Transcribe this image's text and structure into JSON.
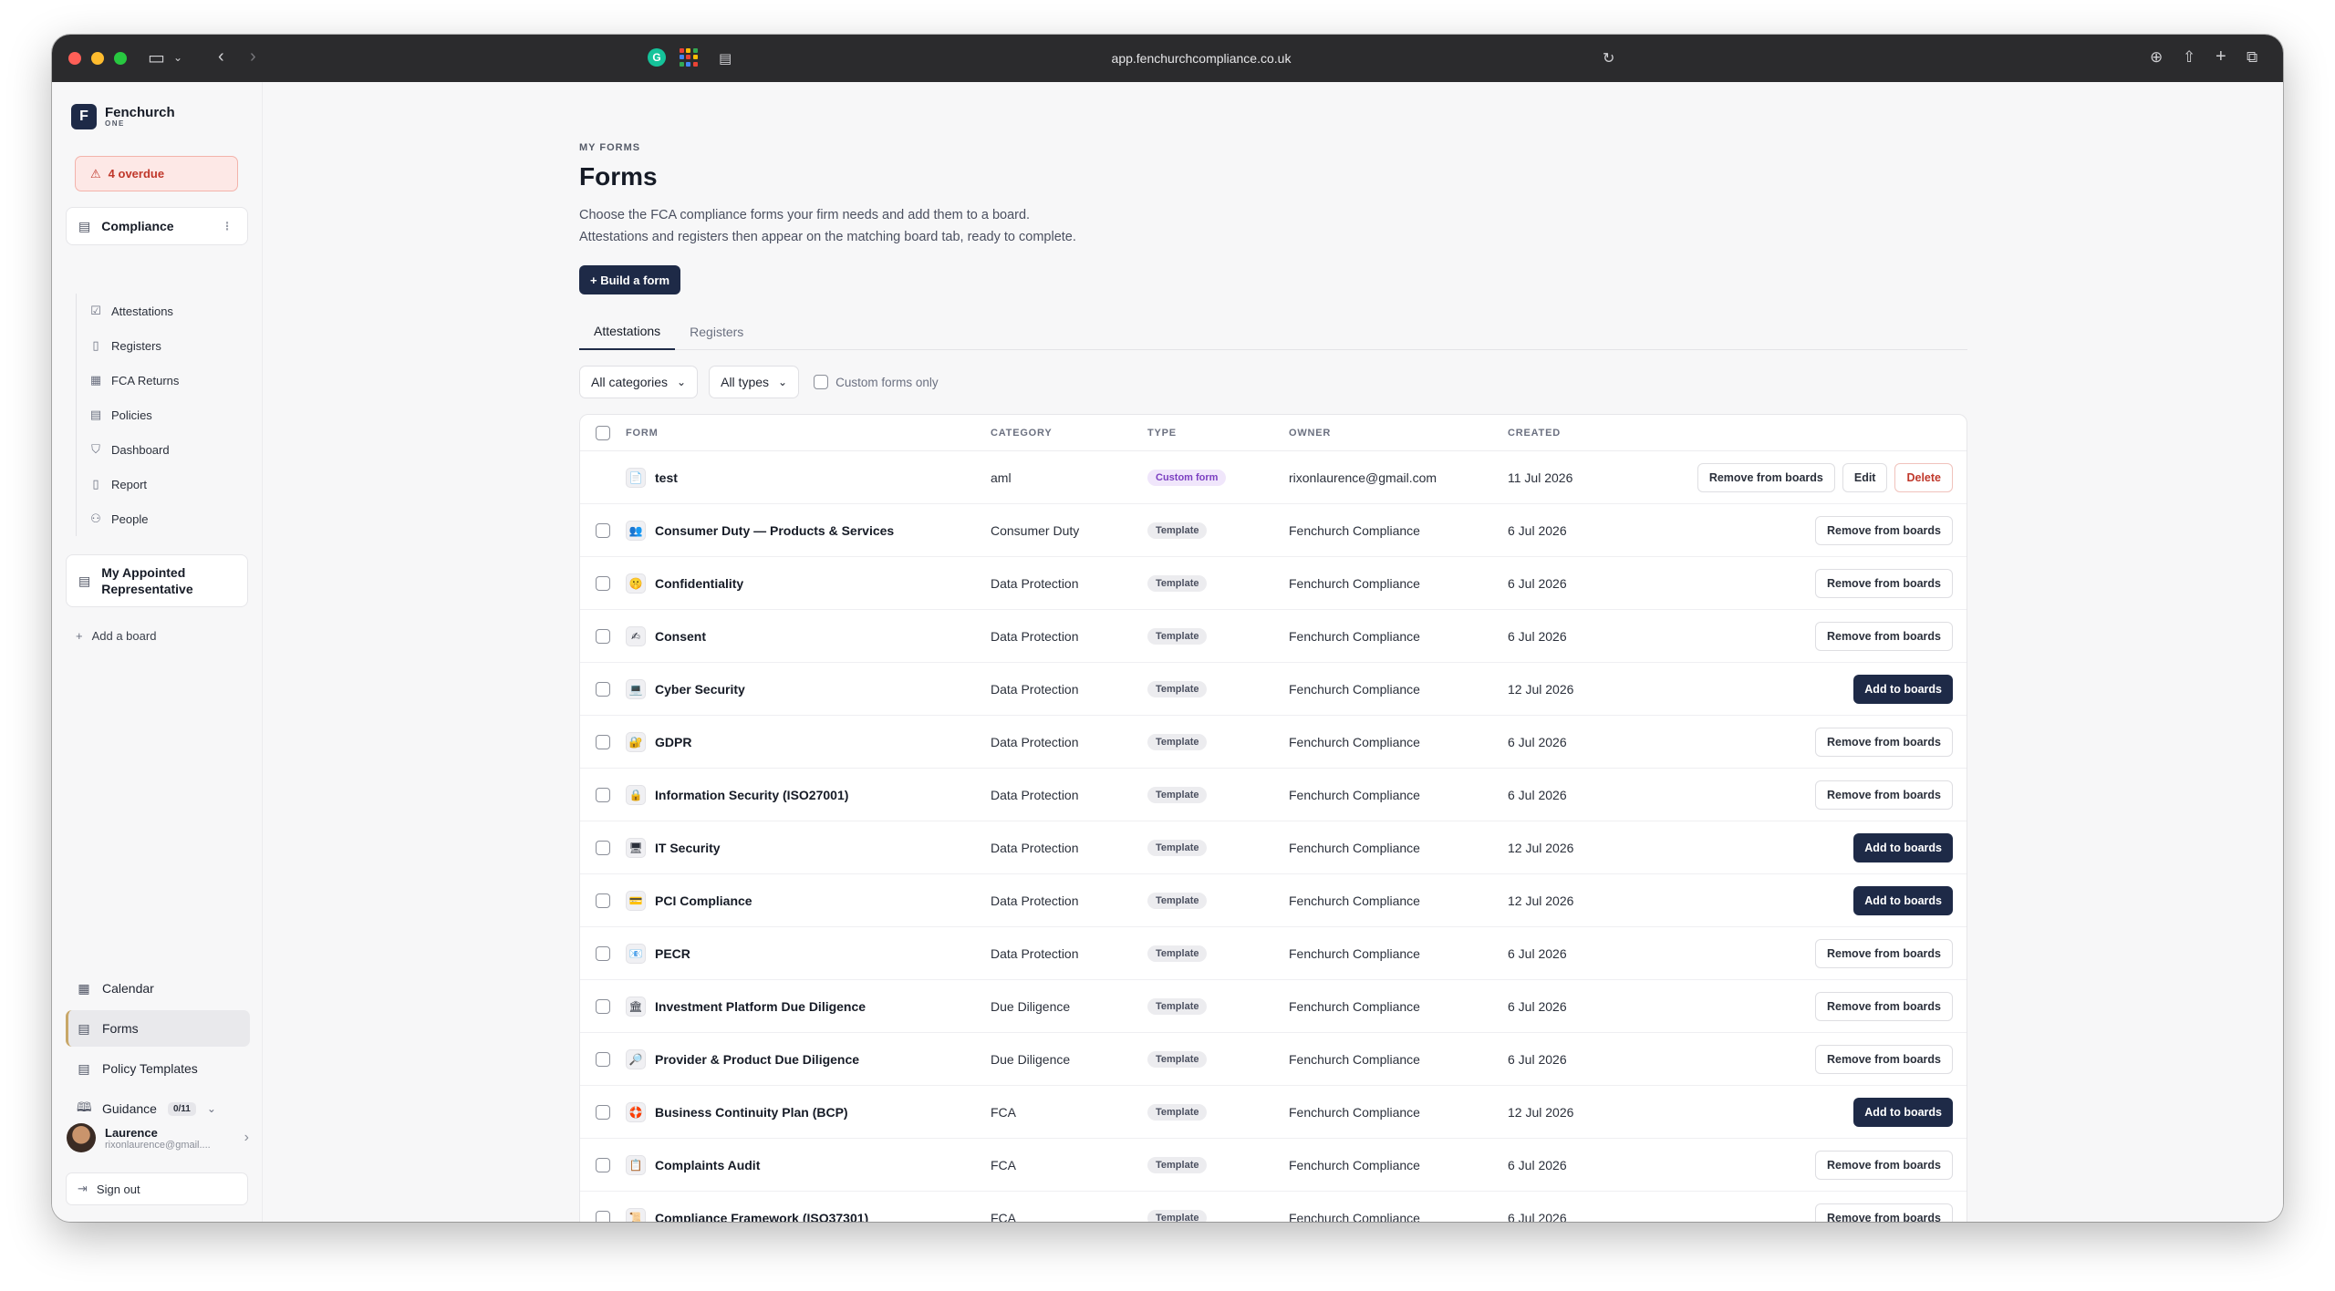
{
  "browser": {
    "url": "app.fenchurchcompliance.co.uk"
  },
  "brand": {
    "name": "Fenchurch",
    "sub": "ONE",
    "logo_letter": "F"
  },
  "alert": {
    "overdue": "4 overdue"
  },
  "sidebar": {
    "compliance_board": "Compliance",
    "compliance_items": [
      {
        "label": "Attestations",
        "icon": "check-square-icon"
      },
      {
        "label": "Registers",
        "icon": "book-icon"
      },
      {
        "label": "FCA Returns",
        "icon": "calendar-icon"
      },
      {
        "label": "Policies",
        "icon": "document-icon"
      },
      {
        "label": "Dashboard",
        "icon": "shield-icon"
      },
      {
        "label": "Report",
        "icon": "file-icon"
      },
      {
        "label": "People",
        "icon": "people-icon"
      }
    ],
    "appointed_board": "My Appointed Representative",
    "add_board": "Add a board",
    "main_nav": [
      {
        "label": "Calendar",
        "icon": "calendar-icon"
      },
      {
        "label": "Forms",
        "icon": "form-icon"
      },
      {
        "label": "Policy Templates",
        "icon": "document-icon"
      },
      {
        "label": "Guidance",
        "icon": "book-open-icon"
      }
    ],
    "guidance_badge": "0/11",
    "user": {
      "name": "Laurence",
      "email": "rixonlaurence@gmail...."
    },
    "sign_out": "Sign out"
  },
  "page": {
    "eyebrow": "MY FORMS",
    "title": "Forms",
    "description_1": "Choose the FCA compliance forms your firm needs and add them to a board.",
    "description_2": "Attestations and registers then appear on the matching board tab, ready to complete.",
    "build_button": "+ Build a form",
    "tabs": [
      "Attestations",
      "Registers"
    ],
    "filters": {
      "category": "All categories",
      "type": "All types",
      "custom_only": "Custom forms only"
    }
  },
  "table": {
    "headers": {
      "form": "FORM",
      "category": "CATEGORY",
      "type": "TYPE",
      "owner": "OWNER",
      "created": "CREATED"
    },
    "rows": [
      {
        "name": "test",
        "icon": "📄",
        "category": "aml",
        "type": "Custom form",
        "owner": "rixonlaurence@gmail.com",
        "created": "11 Jul 2026",
        "actions": [
          "Remove from boards",
          "Edit",
          "Delete"
        ]
      },
      {
        "name": "Consumer Duty — Products & Services",
        "icon": "👥",
        "category": "Consumer Duty",
        "type": "Template",
        "owner": "Fenchurch Compliance",
        "created": "6 Jul 2026",
        "actions": [
          "Remove from boards"
        ]
      },
      {
        "name": "Confidentiality",
        "icon": "🤫",
        "category": "Data Protection",
        "type": "Template",
        "owner": "Fenchurch Compliance",
        "created": "6 Jul 2026",
        "actions": [
          "Remove from boards"
        ]
      },
      {
        "name": "Consent",
        "icon": "✍",
        "category": "Data Protection",
        "type": "Template",
        "owner": "Fenchurch Compliance",
        "created": "6 Jul 2026",
        "actions": [
          "Remove from boards"
        ]
      },
      {
        "name": "Cyber Security",
        "icon": "💻",
        "category": "Data Protection",
        "type": "Template",
        "owner": "Fenchurch Compliance",
        "created": "12 Jul 2026",
        "actions": [
          "Add to boards"
        ]
      },
      {
        "name": "GDPR",
        "icon": "🔐",
        "category": "Data Protection",
        "type": "Template",
        "owner": "Fenchurch Compliance",
        "created": "6 Jul 2026",
        "actions": [
          "Remove from boards"
        ]
      },
      {
        "name": "Information Security (ISO27001)",
        "icon": "🔒",
        "category": "Data Protection",
        "type": "Template",
        "owner": "Fenchurch Compliance",
        "created": "6 Jul 2026",
        "actions": [
          "Remove from boards"
        ]
      },
      {
        "name": "IT Security",
        "icon": "🖥",
        "category": "Data Protection",
        "type": "Template",
        "owner": "Fenchurch Compliance",
        "created": "12 Jul 2026",
        "actions": [
          "Add to boards"
        ]
      },
      {
        "name": "PCI Compliance",
        "icon": "💳",
        "category": "Data Protection",
        "type": "Template",
        "owner": "Fenchurch Compliance",
        "created": "12 Jul 2026",
        "actions": [
          "Add to boards"
        ]
      },
      {
        "name": "PECR",
        "icon": "📧",
        "category": "Data Protection",
        "type": "Template",
        "owner": "Fenchurch Compliance",
        "created": "6 Jul 2026",
        "actions": [
          "Remove from boards"
        ]
      },
      {
        "name": "Investment Platform Due Diligence",
        "icon": "🏛",
        "category": "Due Diligence",
        "type": "Template",
        "owner": "Fenchurch Compliance",
        "created": "6 Jul 2026",
        "actions": [
          "Remove from boards"
        ]
      },
      {
        "name": "Provider & Product Due Diligence",
        "icon": "🔎",
        "category": "Due Diligence",
        "type": "Template",
        "owner": "Fenchurch Compliance",
        "created": "6 Jul 2026",
        "actions": [
          "Remove from boards"
        ]
      },
      {
        "name": "Business Continuity Plan (BCP)",
        "icon": "🛟",
        "category": "FCA",
        "type": "Template",
        "owner": "Fenchurch Compliance",
        "created": "12 Jul 2026",
        "actions": [
          "Add to boards"
        ]
      },
      {
        "name": "Complaints Audit",
        "icon": "📋",
        "category": "FCA",
        "type": "Template",
        "owner": "Fenchurch Compliance",
        "created": "6 Jul 2026",
        "actions": [
          "Remove from boards"
        ]
      },
      {
        "name": "Compliance Framework (ISO37301)",
        "icon": "📜",
        "category": "FCA",
        "type": "Template",
        "owner": "Fenchurch Compliance",
        "created": "6 Jul 2026",
        "actions": [
          "Remove from boards"
        ]
      }
    ]
  },
  "colors": {
    "primary": "#1e2a47",
    "danger": "#c0382b",
    "custom_pill": "#7b3fc1"
  }
}
